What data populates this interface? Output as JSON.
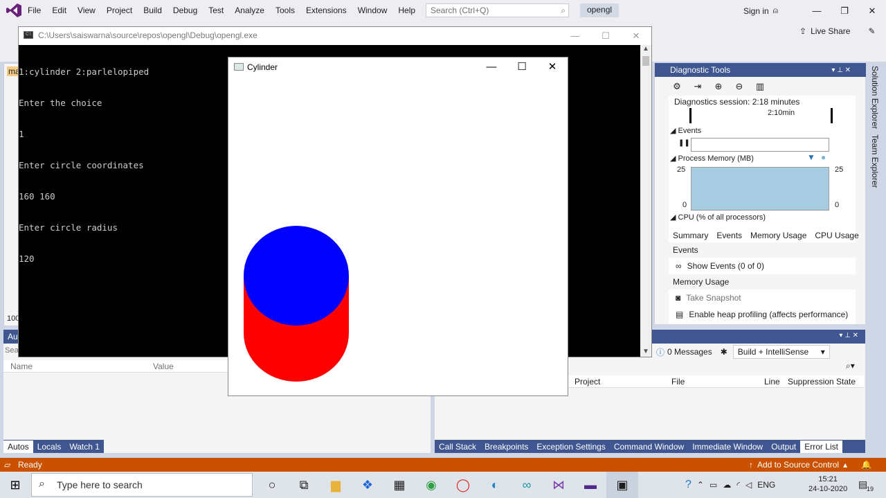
{
  "vs": {
    "menus": [
      "File",
      "Edit",
      "View",
      "Project",
      "Build",
      "Debug",
      "Test",
      "Analyze",
      "Tools",
      "Extensions",
      "Window",
      "Help"
    ],
    "search_placeholder": "Search (Ctrl+Q)",
    "project_name": "opengl",
    "sign_in": "Sign in",
    "live_share": "Live Share"
  },
  "diagnostics": {
    "title": "Diagnostic Tools",
    "session": "Diagnostics session: 2:18 minutes",
    "timeline_label": "2:10min",
    "events_header": "Events",
    "memory_header": "Process Memory (MB)",
    "mem_max_left": "25",
    "mem_min_left": "0",
    "mem_max_right": "25",
    "mem_min_right": "0",
    "cpu_header": "CPU (% of all processors)",
    "tabs": [
      "Summary",
      "Events",
      "Memory Usage",
      "CPU Usage"
    ],
    "events_section": "Events",
    "show_events": "Show Events (0 of 0)",
    "memory_section": "Memory Usage",
    "take_snapshot": "Take Snapshot",
    "heap_profiling": "Enable heap profiling (affects performance)"
  },
  "side_tabs": [
    "Solution Explorer",
    "Team Explorer"
  ],
  "autos": {
    "columns": [
      "Name",
      "Value"
    ],
    "tabs": [
      "Autos",
      "Locals",
      "Watch 1"
    ],
    "left_stub_labels": [
      "ma",
      "100",
      "Au",
      "Sea"
    ]
  },
  "error_list": {
    "messages": "0 Messages",
    "filter": "Build + IntelliSense",
    "columns": [
      "Project",
      "File",
      "Line",
      "Suppression State"
    ],
    "tabs": [
      "Call Stack",
      "Breakpoints",
      "Exception Settings",
      "Command Window",
      "Immediate Window",
      "Output",
      "Error List"
    ]
  },
  "status": {
    "ready": "Ready",
    "source_control": "Add to Source Control"
  },
  "console": {
    "title": "C:\\Users\\saiswarna\\source\\repos\\opengl\\Debug\\opengl.exe",
    "lines": [
      "1:cylinder 2:parlelopiped",
      "Enter the choice",
      "1",
      "Enter circle coordinates",
      "160 160",
      "Enter circle radius",
      "120"
    ]
  },
  "gl_window": {
    "title": "Cylinder",
    "colors": {
      "top": "#0000ff",
      "body": "#ff0000",
      "background": "#ffffff"
    }
  },
  "taskbar": {
    "search_placeholder": "Type here to search",
    "language": "ENG",
    "time": "15:21",
    "date": "24-10-2020",
    "notifications": "19"
  }
}
